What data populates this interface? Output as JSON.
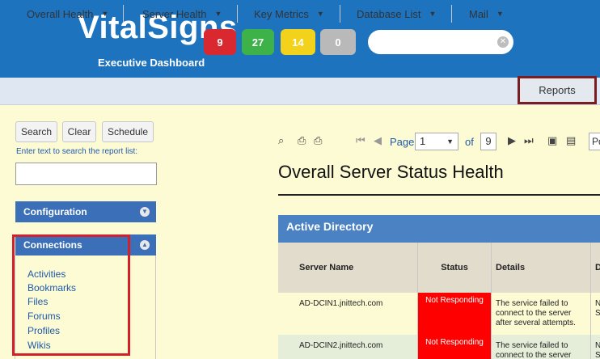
{
  "header": {
    "brand": "VitalSigns",
    "subtitle": "Executive Dashboard",
    "badges": [
      {
        "count": "9",
        "color": "#d9282f"
      },
      {
        "count": "27",
        "color": "#3db249"
      },
      {
        "count": "14",
        "color": "#f2d21b"
      },
      {
        "count": "0",
        "color": "#b9b9b9"
      }
    ],
    "search": {
      "value": "",
      "clear_icon": "clear-icon"
    }
  },
  "nav": {
    "items": [
      {
        "label": "Overall Health"
      },
      {
        "label": "Server Health"
      },
      {
        "label": "Key Metrics"
      },
      {
        "label": "Database List"
      },
      {
        "label": "Mail"
      },
      {
        "label": "Reports"
      }
    ]
  },
  "sidebar": {
    "buttons": {
      "search": "Search",
      "clear": "Clear",
      "schedule": "Schedule"
    },
    "hint": "Enter text to search the report list:",
    "search_value": "",
    "sections": [
      {
        "label": "Configuration"
      },
      {
        "label": "Connections"
      }
    ],
    "connection_links": [
      "Activities",
      "Bookmarks",
      "Files",
      "Forums",
      "Profiles",
      "Wikis"
    ]
  },
  "report": {
    "toolbar": {
      "page_label": "Page",
      "current_page": "1",
      "of_label": "of",
      "total_pages": "9",
      "format": "Pdf"
    },
    "title": "Overall Server Status Health",
    "section": "Active Directory",
    "columns": [
      "Server Name",
      "Status",
      "Details",
      "D"
    ],
    "rows": [
      {
        "server": "AD-DCIN1.jnittech.com",
        "status": "Not Responding",
        "details": "The service failed to connect to the server after several attempts.",
        "d": "N S"
      },
      {
        "server": "AD-DCIN2.jnittech.com",
        "status": "Not Responding",
        "details": "The service failed to connect to the server",
        "d": "N S"
      }
    ]
  },
  "colors": {
    "header_blue": "#1e73be",
    "section_blue": "#3b6fb8",
    "highlight_red": "#d3202b",
    "reports_border": "#7a1d21",
    "status_red": "#ff0000",
    "page_bg": "#fdfbd4"
  }
}
